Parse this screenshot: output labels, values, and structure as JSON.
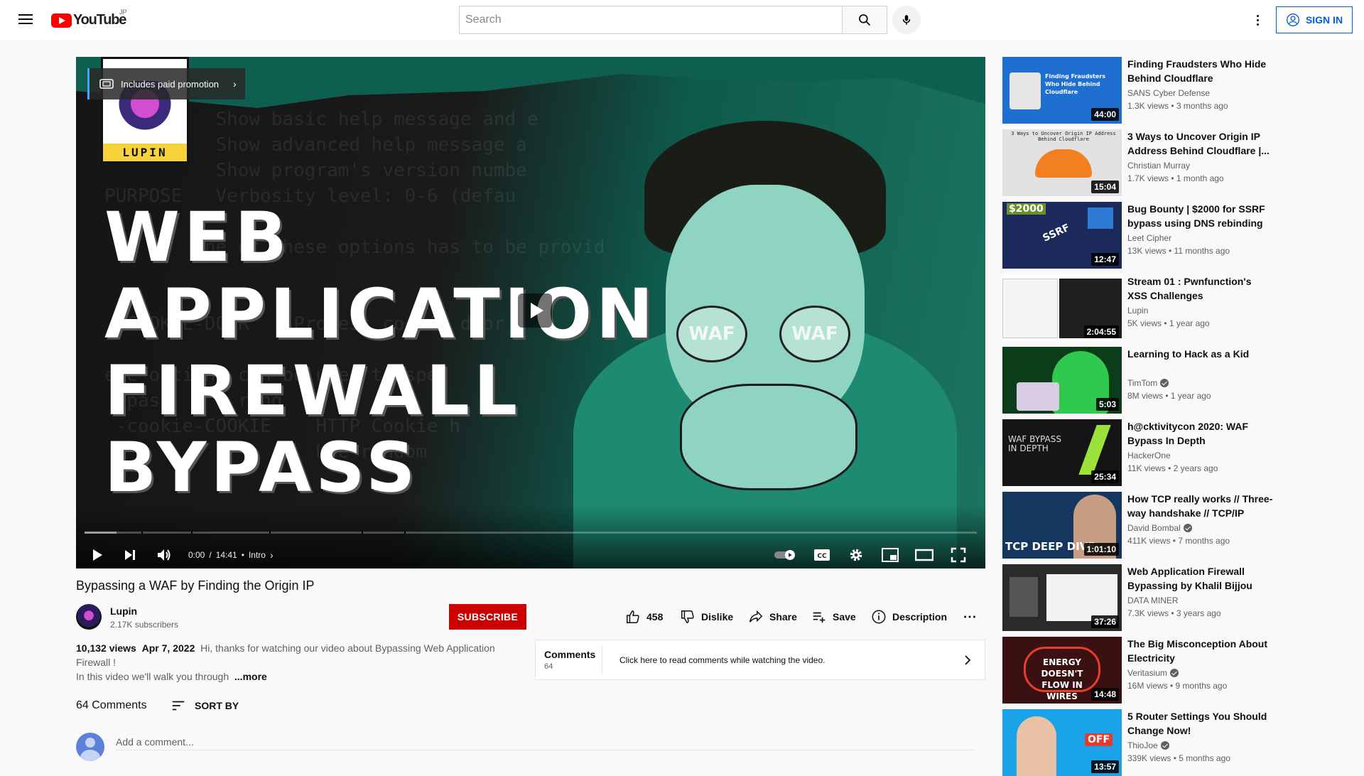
{
  "header": {
    "logo_text": "YouTube",
    "country_code": "JP",
    "search_placeholder": "Search",
    "sign_in_label": "SIGN IN"
  },
  "player": {
    "thumbnail_title_lines": [
      "WEB",
      "APPLICATION",
      "FIREWALL",
      "BYPASS"
    ],
    "channel_logo_text": "LUPIN",
    "glasses_text": "WAF",
    "paid_promotion_label": "Includes paid promotion",
    "time_current": "0:00",
    "time_total": "14:41",
    "time_separator": "/",
    "chapter_label": "Intro",
    "progress_loaded_fraction": 0.036
  },
  "video": {
    "title": "Bypassing a WAF by Finding the Origin IP",
    "channel_name": "Lupin",
    "subscribers": "2.17K subscribers",
    "subscribe_label": "SUBSCRIBE",
    "likes": "458",
    "dislike_label": "Dislike",
    "share_label": "Share",
    "save_label": "Save",
    "description_label": "Description",
    "views": "10,132 views",
    "date": "Apr 7, 2022",
    "description_line1": "Hi, thanks for watching our video about Bypassing Web Application Firewall !",
    "description_line2": "In this video we'll walk you through",
    "more_label": "...more"
  },
  "comments_panel": {
    "title": "Comments",
    "count": "64",
    "message": "Click here to read comments while watching the video."
  },
  "comments": {
    "heading": "64 Comments",
    "sort_label": "SORT BY",
    "add_placeholder": "Add a comment..."
  },
  "recommendations": [
    {
      "title": "Finding Fraudsters Who Hide Behind Cloudflare",
      "channel": "SANS Cyber Defense",
      "verified": false,
      "meta": "1.3K views • 3 months ago",
      "duration": "44:00",
      "thumb_color": "#1f6fd0"
    },
    {
      "title": "3 Ways to Uncover Origin IP Address Behind Cloudflare |...",
      "channel": "Christian Murray",
      "verified": false,
      "meta": "1.7K views • 1 month ago",
      "duration": "15:04",
      "thumb_color": "#d9d9d9"
    },
    {
      "title": "Bug Bounty | $2000 for SSRF bypass using DNS rebinding",
      "channel": "Leet Cipher",
      "verified": false,
      "meta": "13K views • 11 months ago",
      "duration": "12:47",
      "thumb_color": "#1b2a5a"
    },
    {
      "title": "Stream 01 : Pwnfunction's XSS Challenges",
      "channel": "Lupin",
      "verified": false,
      "meta": "5K views • 1 year ago",
      "duration": "2:04:55",
      "thumb_color": "#202124"
    },
    {
      "title": "Learning to Hack as a Kid",
      "channel": "TimTom",
      "verified": true,
      "meta": "8M views • 1 year ago",
      "duration": "5:03",
      "thumb_color": "#2fa84f"
    },
    {
      "title": "h@cktivitycon 2020: WAF Bypass In Depth",
      "channel": "HackerOne",
      "verified": false,
      "meta": "11K views • 2 years ago",
      "duration": "25:34",
      "thumb_color": "#151515"
    },
    {
      "title": "How TCP really works // Three-way handshake // TCP/IP Dee...",
      "channel": "David Bombal",
      "verified": true,
      "meta": "411K views • 7 months ago",
      "duration": "1:01:10",
      "thumb_color": "#15365e"
    },
    {
      "title": "Web Application Firewall Bypassing by Khalil Bijjou",
      "channel": "DATA MINER",
      "verified": false,
      "meta": "7.3K views • 3 years ago",
      "duration": "37:26",
      "thumb_color": "#333"
    },
    {
      "title": "The Big Misconception About Electricity",
      "channel": "Veritasium",
      "verified": true,
      "meta": "16M views • 9 months ago",
      "duration": "14:48",
      "thumb_color": "#3a1010"
    },
    {
      "title": "5 Router Settings You Should Change Now!",
      "channel": "ThioJoe",
      "verified": true,
      "meta": "339K views • 5 months ago",
      "duration": "13:57",
      "thumb_color": "#1aa3e8"
    }
  ],
  "thumb_texts": {
    "t0": "Finding Fraudsters Who Hide Behind Cloudflare",
    "t1": "3 Ways to Uncover Origin IP Address Behind Cloudflare",
    "t2a": "$2000",
    "t2b": "SSRF",
    "t5a": "WAF BYPASS IN DEPTH",
    "t6a": "TCP DEEP DIVE",
    "t8a": "ENERGY DOESN'T FLOW IN WIRES",
    "t9a": "OFF"
  }
}
